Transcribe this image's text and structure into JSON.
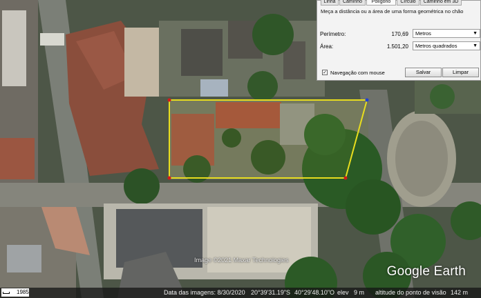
{
  "map": {
    "copyright": "Image ©2021 Maxar Technologies",
    "brand": "Google Earth",
    "polygon_edge_color": "#e8dd1e",
    "vertex_color": "#d21a1a"
  },
  "status_bar": {
    "year": "1985",
    "image_date": "Data das imagens: 8/30/2020",
    "latitude": "20°39'31.19\"S",
    "longitude": "40°29'48.10\"O",
    "elevation_label": "elev",
    "elevation": "9 m",
    "eye_alt_label": "altitude do ponto de visão",
    "eye_alt": "142 m"
  },
  "panel": {
    "tabs": [
      "Linha",
      "Caminho",
      "Polígono",
      "Círculo",
      "Caminho em 3D"
    ],
    "active_tab": "Polígono",
    "description": "Meça a distância ou a área de uma forma geométrica no chão",
    "perimeter_label": "Perímetro:",
    "perimeter_value": "170,69",
    "perimeter_unit": "Metros",
    "area_label": "Área:",
    "area_value": "1.501,20",
    "area_unit": "Metros quadrados",
    "mouse_nav_label": "Navegação com mouse",
    "mouse_nav_checked": true,
    "save_label": "Salvar",
    "clear_label": "Limpar"
  }
}
